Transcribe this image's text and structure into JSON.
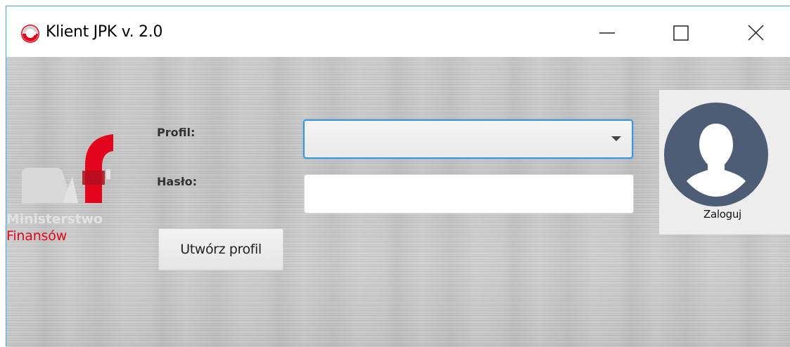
{
  "window": {
    "title": "Klient JPK v. 2.0",
    "accent_color": "#37a6e3",
    "controls": {
      "minimize_icon": "minimize-icon",
      "maximize_icon": "maximize-icon",
      "close_icon": "close-icon"
    }
  },
  "logo": {
    "line1": "Ministerstwo",
    "line2": "Finansów",
    "brand_color": "#e3051b"
  },
  "form": {
    "profile_label": "Profil:",
    "profile_value": "",
    "password_label": "Hasło:",
    "password_value": "",
    "create_profile_label": "Utwórz profil"
  },
  "login": {
    "label": "Zaloguj",
    "avatar_icon": "user-avatar-icon",
    "avatar_color": "#4d5d75"
  }
}
